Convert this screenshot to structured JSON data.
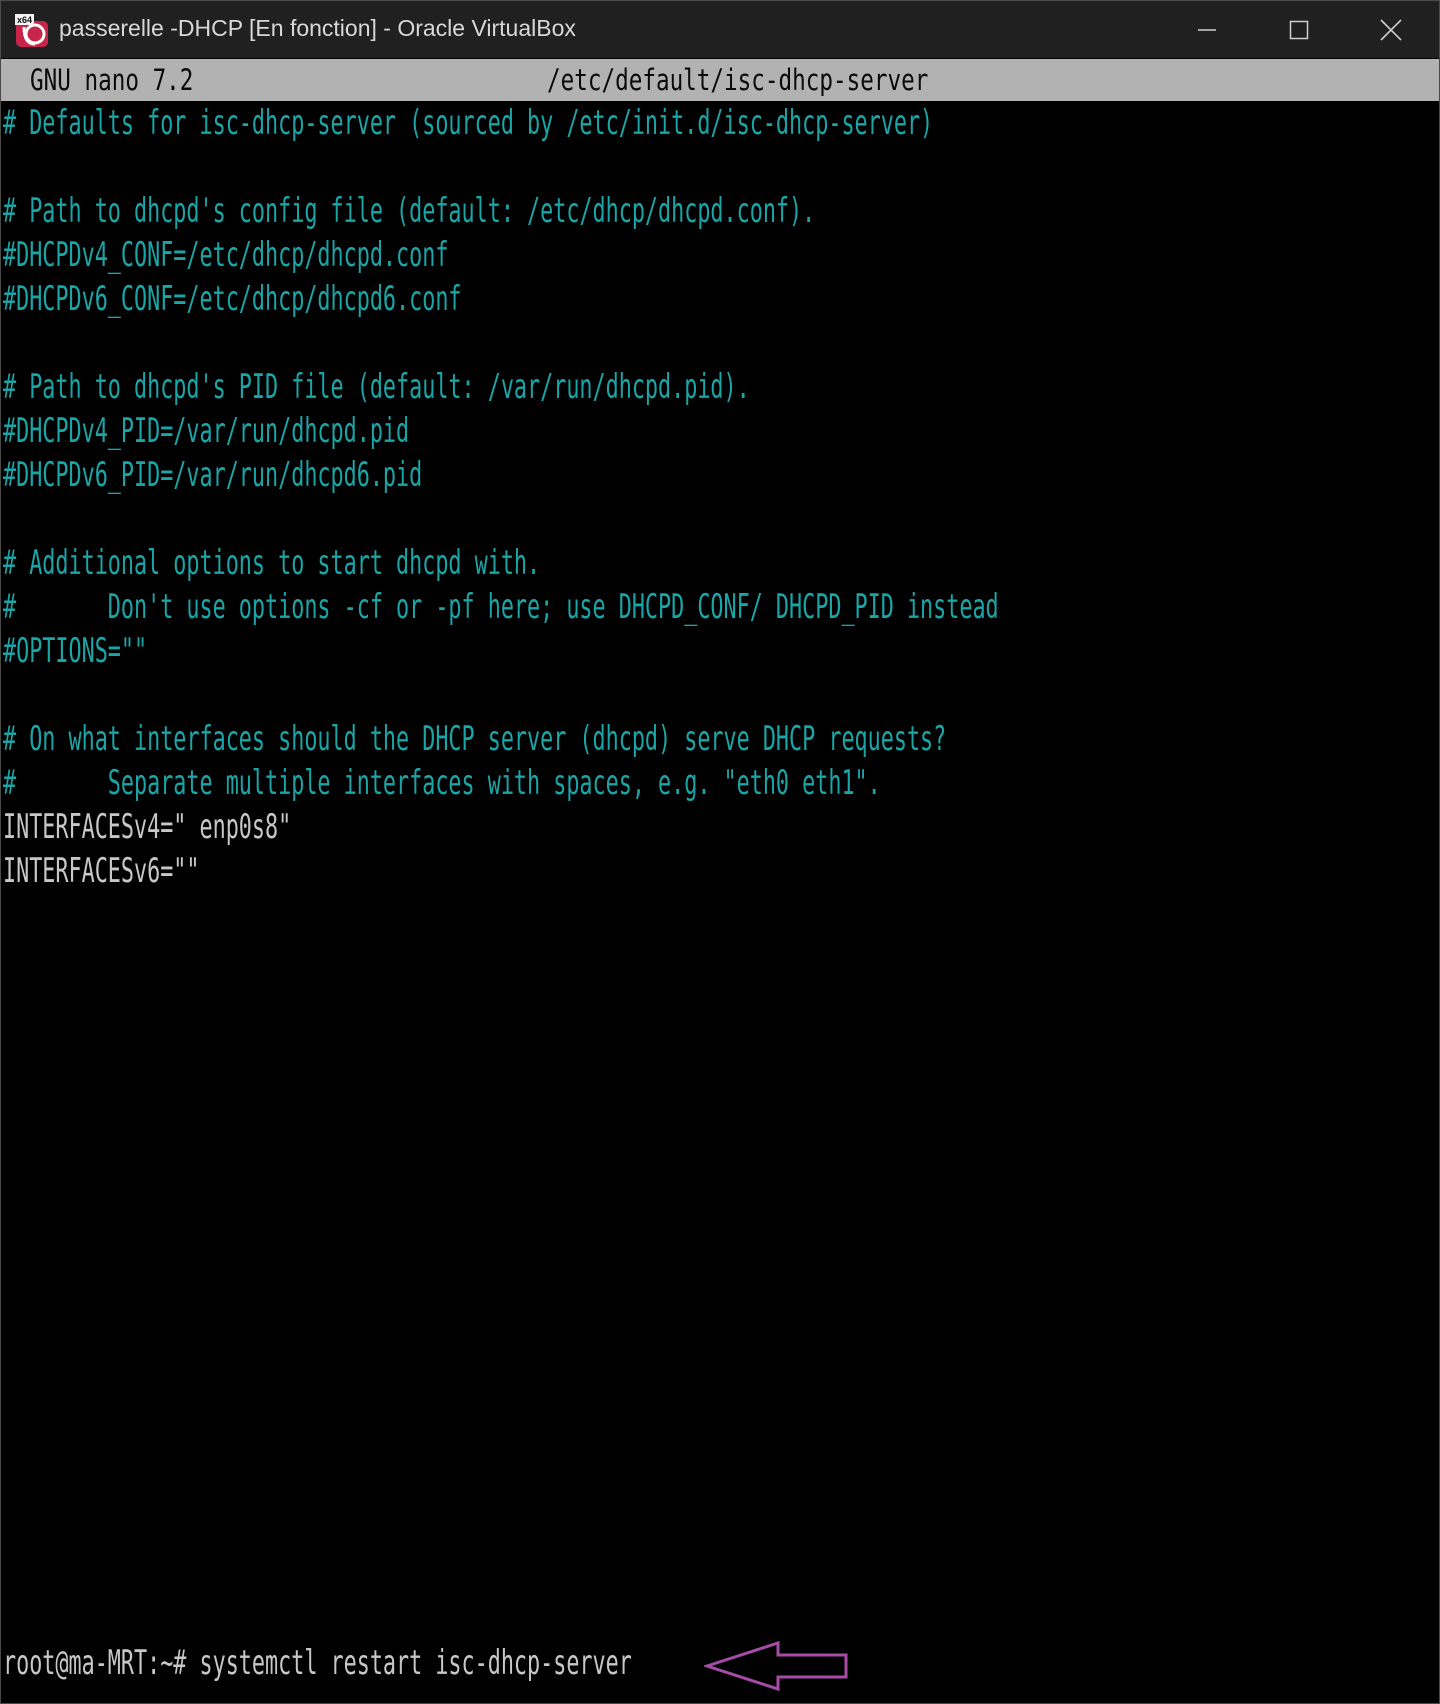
{
  "window": {
    "title": "passerelle -DHCP [En fonction] - Oracle VirtualBox",
    "icon_badge": "x64"
  },
  "nano": {
    "version": "GNU nano 7.2",
    "filename": "/etc/default/isc-dhcp-server"
  },
  "file_lines": [
    "# Defaults for isc-dhcp-server (sourced by /etc/init.d/isc-dhcp-server)",
    "",
    "# Path to dhcpd's config file (default: /etc/dhcp/dhcpd.conf).",
    "#DHCPDv4_CONF=/etc/dhcp/dhcpd.conf",
    "#DHCPDv6_CONF=/etc/dhcp/dhcpd6.conf",
    "",
    "# Path to dhcpd's PID file (default: /var/run/dhcpd.pid).",
    "#DHCPDv4_PID=/var/run/dhcpd.pid",
    "#DHCPDv6_PID=/var/run/dhcpd6.pid",
    "",
    "# Additional options to start dhcpd with.",
    "#       Don't use options -cf or -pf here; use DHCPD_CONF/ DHCPD_PID instead",
    "#OPTIONS=\"\"",
    "",
    "# On what interfaces should the DHCP server (dhcpd) serve DHCP requests?",
    "#       Separate multiple interfaces with spaces, e.g. \"eth0 eth1\".",
    "INTERFACESv4=\" enp0s8\"",
    "INTERFACESv6=\"\""
  ],
  "prompt": {
    "text": "root@ma-MRT:~# systemctl restart isc-dhcp-server"
  },
  "colors": {
    "comment": "#1aa5a7",
    "code": "#c7c7c7",
    "header_bg": "#b2b2b2",
    "titlebar_bg": "#202020",
    "arrow": "#a64ca6"
  },
  "icons": {
    "app": "virtualbox-icon",
    "minimize": "minimize-icon",
    "maximize": "maximize-icon",
    "close": "close-icon",
    "annotation": "arrow-left-icon"
  }
}
